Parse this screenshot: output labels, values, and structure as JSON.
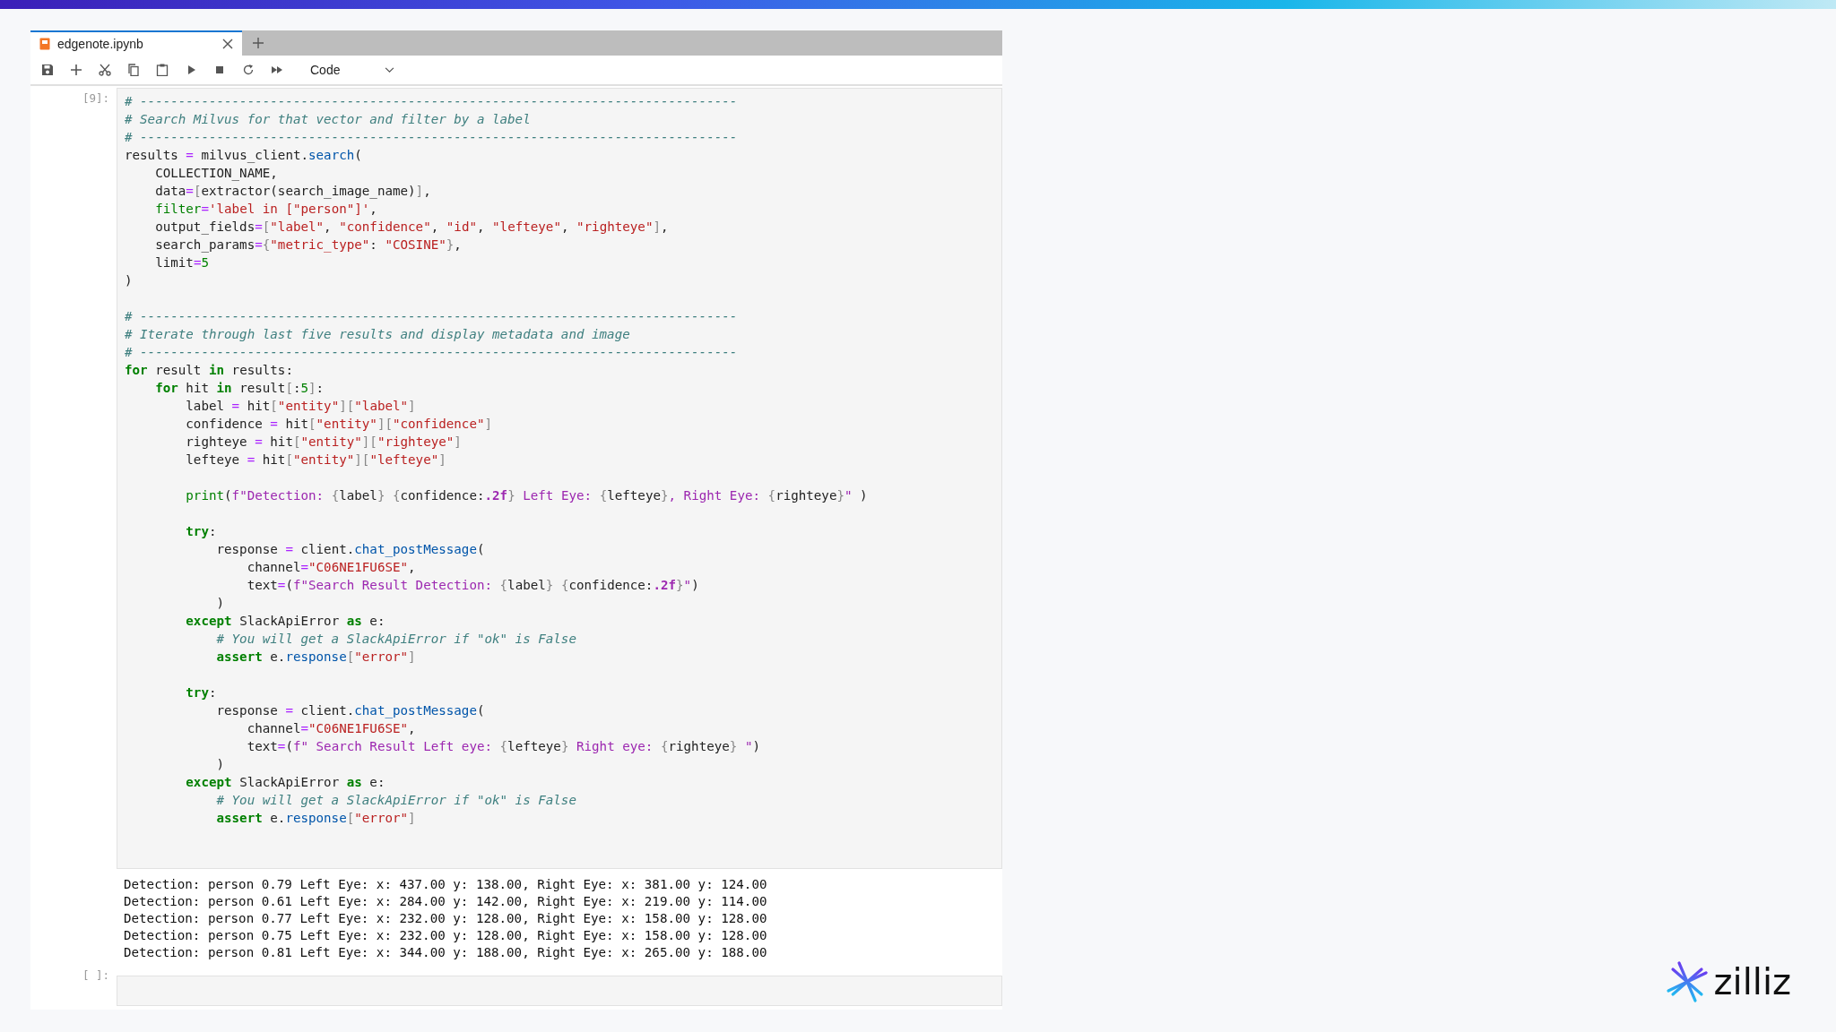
{
  "tab": {
    "title": "edgenote.ipynb",
    "selected": true
  },
  "toolbar": {
    "cell_type": "Code"
  },
  "cells": [
    {
      "prompt": "[9]:",
      "code": [
        [
          [
            {
              "kind": "comment",
              "text": "# ------------------------------------------------------------------------------"
            }
          ],
          [
            {
              "kind": "comment",
              "text": "# Search Milvus for that vector and filter by a label"
            }
          ],
          [
            {
              "kind": "comment",
              "text": "# ------------------------------------------------------------------------------"
            }
          ],
          [
            {
              "kind": "plain",
              "text": "results "
            },
            {
              "kind": "op",
              "text": "="
            },
            {
              "kind": "plain",
              "text": " milvus_client."
            },
            {
              "kind": "fn",
              "text": "search"
            },
            {
              "kind": "plain",
              "text": "("
            }
          ],
          [
            {
              "kind": "plain",
              "text": "    COLLECTION_NAME,"
            }
          ],
          [
            {
              "kind": "plain",
              "text": "    data"
            },
            {
              "kind": "op",
              "text": "="
            },
            {
              "kind": "punc",
              "text": "["
            },
            {
              "kind": "plain",
              "text": "extractor(search_image_name)"
            },
            {
              "kind": "punc",
              "text": "]"
            },
            {
              "kind": "plain",
              "text": ","
            }
          ],
          [
            {
              "kind": "builtin",
              "text": "    filter"
            },
            {
              "kind": "op",
              "text": "="
            },
            {
              "kind": "str",
              "text": "'label in [\"person\"]'"
            },
            {
              "kind": "plain",
              "text": ","
            }
          ],
          [
            {
              "kind": "plain",
              "text": "    output_fields"
            },
            {
              "kind": "op",
              "text": "="
            },
            {
              "kind": "punc",
              "text": "["
            },
            {
              "kind": "str",
              "text": "\"label\""
            },
            {
              "kind": "plain",
              "text": ", "
            },
            {
              "kind": "str",
              "text": "\"confidence\""
            },
            {
              "kind": "plain",
              "text": ", "
            },
            {
              "kind": "str",
              "text": "\"id\""
            },
            {
              "kind": "plain",
              "text": ", "
            },
            {
              "kind": "str",
              "text": "\"lefteye\""
            },
            {
              "kind": "plain",
              "text": ", "
            },
            {
              "kind": "str",
              "text": "\"righteye\""
            },
            {
              "kind": "punc",
              "text": "]"
            },
            {
              "kind": "plain",
              "text": ","
            }
          ],
          [
            {
              "kind": "plain",
              "text": "    search_params"
            },
            {
              "kind": "op",
              "text": "="
            },
            {
              "kind": "punc",
              "text": "{"
            },
            {
              "kind": "str",
              "text": "\"metric_type\""
            },
            {
              "kind": "plain",
              "text": ": "
            },
            {
              "kind": "str",
              "text": "\"COSINE\""
            },
            {
              "kind": "punc",
              "text": "}"
            },
            {
              "kind": "plain",
              "text": ","
            }
          ],
          [
            {
              "kind": "plain",
              "text": "    limit"
            },
            {
              "kind": "op",
              "text": "="
            },
            {
              "kind": "num",
              "text": "5"
            }
          ],
          [
            {
              "kind": "plain",
              "text": ")"
            }
          ]
        ],
        [
          [
            {
              "kind": "comment",
              "text": "# ------------------------------------------------------------------------------"
            }
          ],
          [
            {
              "kind": "comment",
              "text": "# Iterate through last five results and display metadata and image"
            }
          ],
          [
            {
              "kind": "comment",
              "text": "# ------------------------------------------------------------------------------"
            }
          ],
          [
            {
              "kind": "kw",
              "text": "for"
            },
            {
              "kind": "plain",
              "text": " result "
            },
            {
              "kind": "kw",
              "text": "in"
            },
            {
              "kind": "plain",
              "text": " results:"
            }
          ],
          [
            {
              "kind": "kw",
              "text": "    for"
            },
            {
              "kind": "plain",
              "text": " hit "
            },
            {
              "kind": "kw",
              "text": "in"
            },
            {
              "kind": "plain",
              "text": " result"
            },
            {
              "kind": "punc",
              "text": "["
            },
            {
              "kind": "plain",
              "text": ":"
            },
            {
              "kind": "num",
              "text": "5"
            },
            {
              "kind": "punc",
              "text": "]"
            },
            {
              "kind": "plain",
              "text": ":"
            }
          ],
          [
            {
              "kind": "plain",
              "text": "        label "
            },
            {
              "kind": "op",
              "text": "="
            },
            {
              "kind": "plain",
              "text": " hit"
            },
            {
              "kind": "punc",
              "text": "["
            },
            {
              "kind": "str",
              "text": "\"entity\""
            },
            {
              "kind": "punc",
              "text": "]["
            },
            {
              "kind": "str",
              "text": "\"label\""
            },
            {
              "kind": "punc",
              "text": "]"
            }
          ],
          [
            {
              "kind": "plain",
              "text": "        confidence "
            },
            {
              "kind": "op",
              "text": "="
            },
            {
              "kind": "plain",
              "text": " hit"
            },
            {
              "kind": "punc",
              "text": "["
            },
            {
              "kind": "str",
              "text": "\"entity\""
            },
            {
              "kind": "punc",
              "text": "]["
            },
            {
              "kind": "str",
              "text": "\"confidence\""
            },
            {
              "kind": "punc",
              "text": "]"
            }
          ],
          [
            {
              "kind": "plain",
              "text": "        righteye "
            },
            {
              "kind": "op",
              "text": "="
            },
            {
              "kind": "plain",
              "text": " hit"
            },
            {
              "kind": "punc",
              "text": "["
            },
            {
              "kind": "str",
              "text": "\"entity\""
            },
            {
              "kind": "punc",
              "text": "]["
            },
            {
              "kind": "str",
              "text": "\"righteye\""
            },
            {
              "kind": "punc",
              "text": "]"
            }
          ],
          [
            {
              "kind": "plain",
              "text": "        lefteye "
            },
            {
              "kind": "op",
              "text": "="
            },
            {
              "kind": "plain",
              "text": " hit"
            },
            {
              "kind": "punc",
              "text": "["
            },
            {
              "kind": "str",
              "text": "\"entity\""
            },
            {
              "kind": "punc",
              "text": "]["
            },
            {
              "kind": "str",
              "text": "\"lefteye\""
            },
            {
              "kind": "punc",
              "text": "]"
            }
          ]
        ],
        [
          [
            {
              "kind": "builtin",
              "text": "        print"
            },
            {
              "kind": "plain",
              "text": "("
            },
            {
              "kind": "fstr",
              "text": "f\"Detection: "
            },
            {
              "kind": "punc",
              "text": "{"
            },
            {
              "kind": "plain",
              "text": "label"
            },
            {
              "kind": "punc",
              "text": "} {"
            },
            {
              "kind": "plain",
              "text": "confidence:"
            },
            {
              "kind": "fmt",
              "text": ".2f"
            },
            {
              "kind": "punc",
              "text": "}"
            },
            {
              "kind": "fstr",
              "text": " Left Eye: "
            },
            {
              "kind": "punc",
              "text": "{"
            },
            {
              "kind": "plain",
              "text": "lefteye"
            },
            {
              "kind": "punc",
              "text": "}"
            },
            {
              "kind": "fstr",
              "text": ", Right Eye: "
            },
            {
              "kind": "punc",
              "text": "{"
            },
            {
              "kind": "plain",
              "text": "righteye"
            },
            {
              "kind": "punc",
              "text": "}"
            },
            {
              "kind": "fstr",
              "text": "\""
            },
            {
              "kind": "plain",
              "text": " )"
            }
          ]
        ],
        [
          [
            {
              "kind": "kw",
              "text": "        try"
            },
            {
              "kind": "plain",
              "text": ":"
            }
          ],
          [
            {
              "kind": "plain",
              "text": "            response "
            },
            {
              "kind": "op",
              "text": "="
            },
            {
              "kind": "plain",
              "text": " client."
            },
            {
              "kind": "fn",
              "text": "chat_postMessage"
            },
            {
              "kind": "plain",
              "text": "("
            }
          ],
          [
            {
              "kind": "plain",
              "text": "                channel"
            },
            {
              "kind": "op",
              "text": "="
            },
            {
              "kind": "str",
              "text": "\"C06NE1FU6SE\""
            },
            {
              "kind": "plain",
              "text": ","
            }
          ],
          [
            {
              "kind": "plain",
              "text": "                text"
            },
            {
              "kind": "op",
              "text": "="
            },
            {
              "kind": "plain",
              "text": "("
            },
            {
              "kind": "fstr",
              "text": "f\"Search Result Detection: "
            },
            {
              "kind": "punc",
              "text": "{"
            },
            {
              "kind": "plain",
              "text": "label"
            },
            {
              "kind": "punc",
              "text": "} {"
            },
            {
              "kind": "plain",
              "text": "confidence:"
            },
            {
              "kind": "fmt",
              "text": ".2f"
            },
            {
              "kind": "punc",
              "text": "}"
            },
            {
              "kind": "fstr",
              "text": "\""
            },
            {
              "kind": "plain",
              "text": ")"
            }
          ],
          [
            {
              "kind": "plain",
              "text": "            )"
            }
          ],
          [
            {
              "kind": "kw",
              "text": "        except"
            },
            {
              "kind": "plain",
              "text": " SlackApiError "
            },
            {
              "kind": "kw",
              "text": "as"
            },
            {
              "kind": "plain",
              "text": " e:"
            }
          ],
          [
            {
              "kind": "comment",
              "text": "            # You will get a SlackApiError if \"ok\" is False"
            }
          ],
          [
            {
              "kind": "kw",
              "text": "            assert"
            },
            {
              "kind": "plain",
              "text": " e."
            },
            {
              "kind": "fn",
              "text": "response"
            },
            {
              "kind": "punc",
              "text": "["
            },
            {
              "kind": "str",
              "text": "\"error\""
            },
            {
              "kind": "punc",
              "text": "]"
            }
          ]
        ],
        [
          [
            {
              "kind": "kw",
              "text": "        try"
            },
            {
              "kind": "plain",
              "text": ":"
            }
          ],
          [
            {
              "kind": "plain",
              "text": "            response "
            },
            {
              "kind": "op",
              "text": "="
            },
            {
              "kind": "plain",
              "text": " client."
            },
            {
              "kind": "fn",
              "text": "chat_postMessage"
            },
            {
              "kind": "plain",
              "text": "("
            }
          ],
          [
            {
              "kind": "plain",
              "text": "                channel"
            },
            {
              "kind": "op",
              "text": "="
            },
            {
              "kind": "str",
              "text": "\"C06NE1FU6SE\""
            },
            {
              "kind": "plain",
              "text": ","
            }
          ],
          [
            {
              "kind": "plain",
              "text": "                text"
            },
            {
              "kind": "op",
              "text": "="
            },
            {
              "kind": "plain",
              "text": "("
            },
            {
              "kind": "fstr",
              "text": "f\" Search Result Left eye: "
            },
            {
              "kind": "punc",
              "text": "{"
            },
            {
              "kind": "plain",
              "text": "lefteye"
            },
            {
              "kind": "punc",
              "text": "}"
            },
            {
              "kind": "fstr",
              "text": " Right eye: "
            },
            {
              "kind": "punc",
              "text": "{"
            },
            {
              "kind": "plain",
              "text": "righteye"
            },
            {
              "kind": "punc",
              "text": "}"
            },
            {
              "kind": "fstr",
              "text": " \""
            },
            {
              "kind": "plain",
              "text": ")"
            }
          ],
          [
            {
              "kind": "plain",
              "text": "            )"
            }
          ],
          [
            {
              "kind": "kw",
              "text": "        except"
            },
            {
              "kind": "plain",
              "text": " SlackApiError "
            },
            {
              "kind": "kw",
              "text": "as"
            },
            {
              "kind": "plain",
              "text": " e:"
            }
          ],
          [
            {
              "kind": "comment",
              "text": "            # You will get a SlackApiError if \"ok\" is False"
            }
          ],
          [
            {
              "kind": "kw",
              "text": "            assert"
            },
            {
              "kind": "plain",
              "text": " e."
            },
            {
              "kind": "fn",
              "text": "response"
            },
            {
              "kind": "punc",
              "text": "["
            },
            {
              "kind": "str",
              "text": "\"error\""
            },
            {
              "kind": "punc",
              "text": "]"
            }
          ]
        ]
      ],
      "output": [
        "Detection: person 0.79 Left Eye: x: 437.00 y: 138.00, Right Eye: x: 381.00 y: 124.00",
        "Detection: person 0.61 Left Eye: x: 284.00 y: 142.00, Right Eye: x: 219.00 y: 114.00",
        "Detection: person 0.77 Left Eye: x: 232.00 y: 128.00, Right Eye: x: 158.00 y: 128.00",
        "Detection: person 0.75 Left Eye: x: 232.00 y: 128.00, Right Eye: x: 158.00 y: 128.00",
        "Detection: person 0.81 Left Eye: x: 344.00 y: 188.00, Right Eye: x: 265.00 y: 188.00"
      ]
    },
    {
      "prompt": "[ ]:"
    }
  ],
  "logo": {
    "text": "zilliz"
  }
}
